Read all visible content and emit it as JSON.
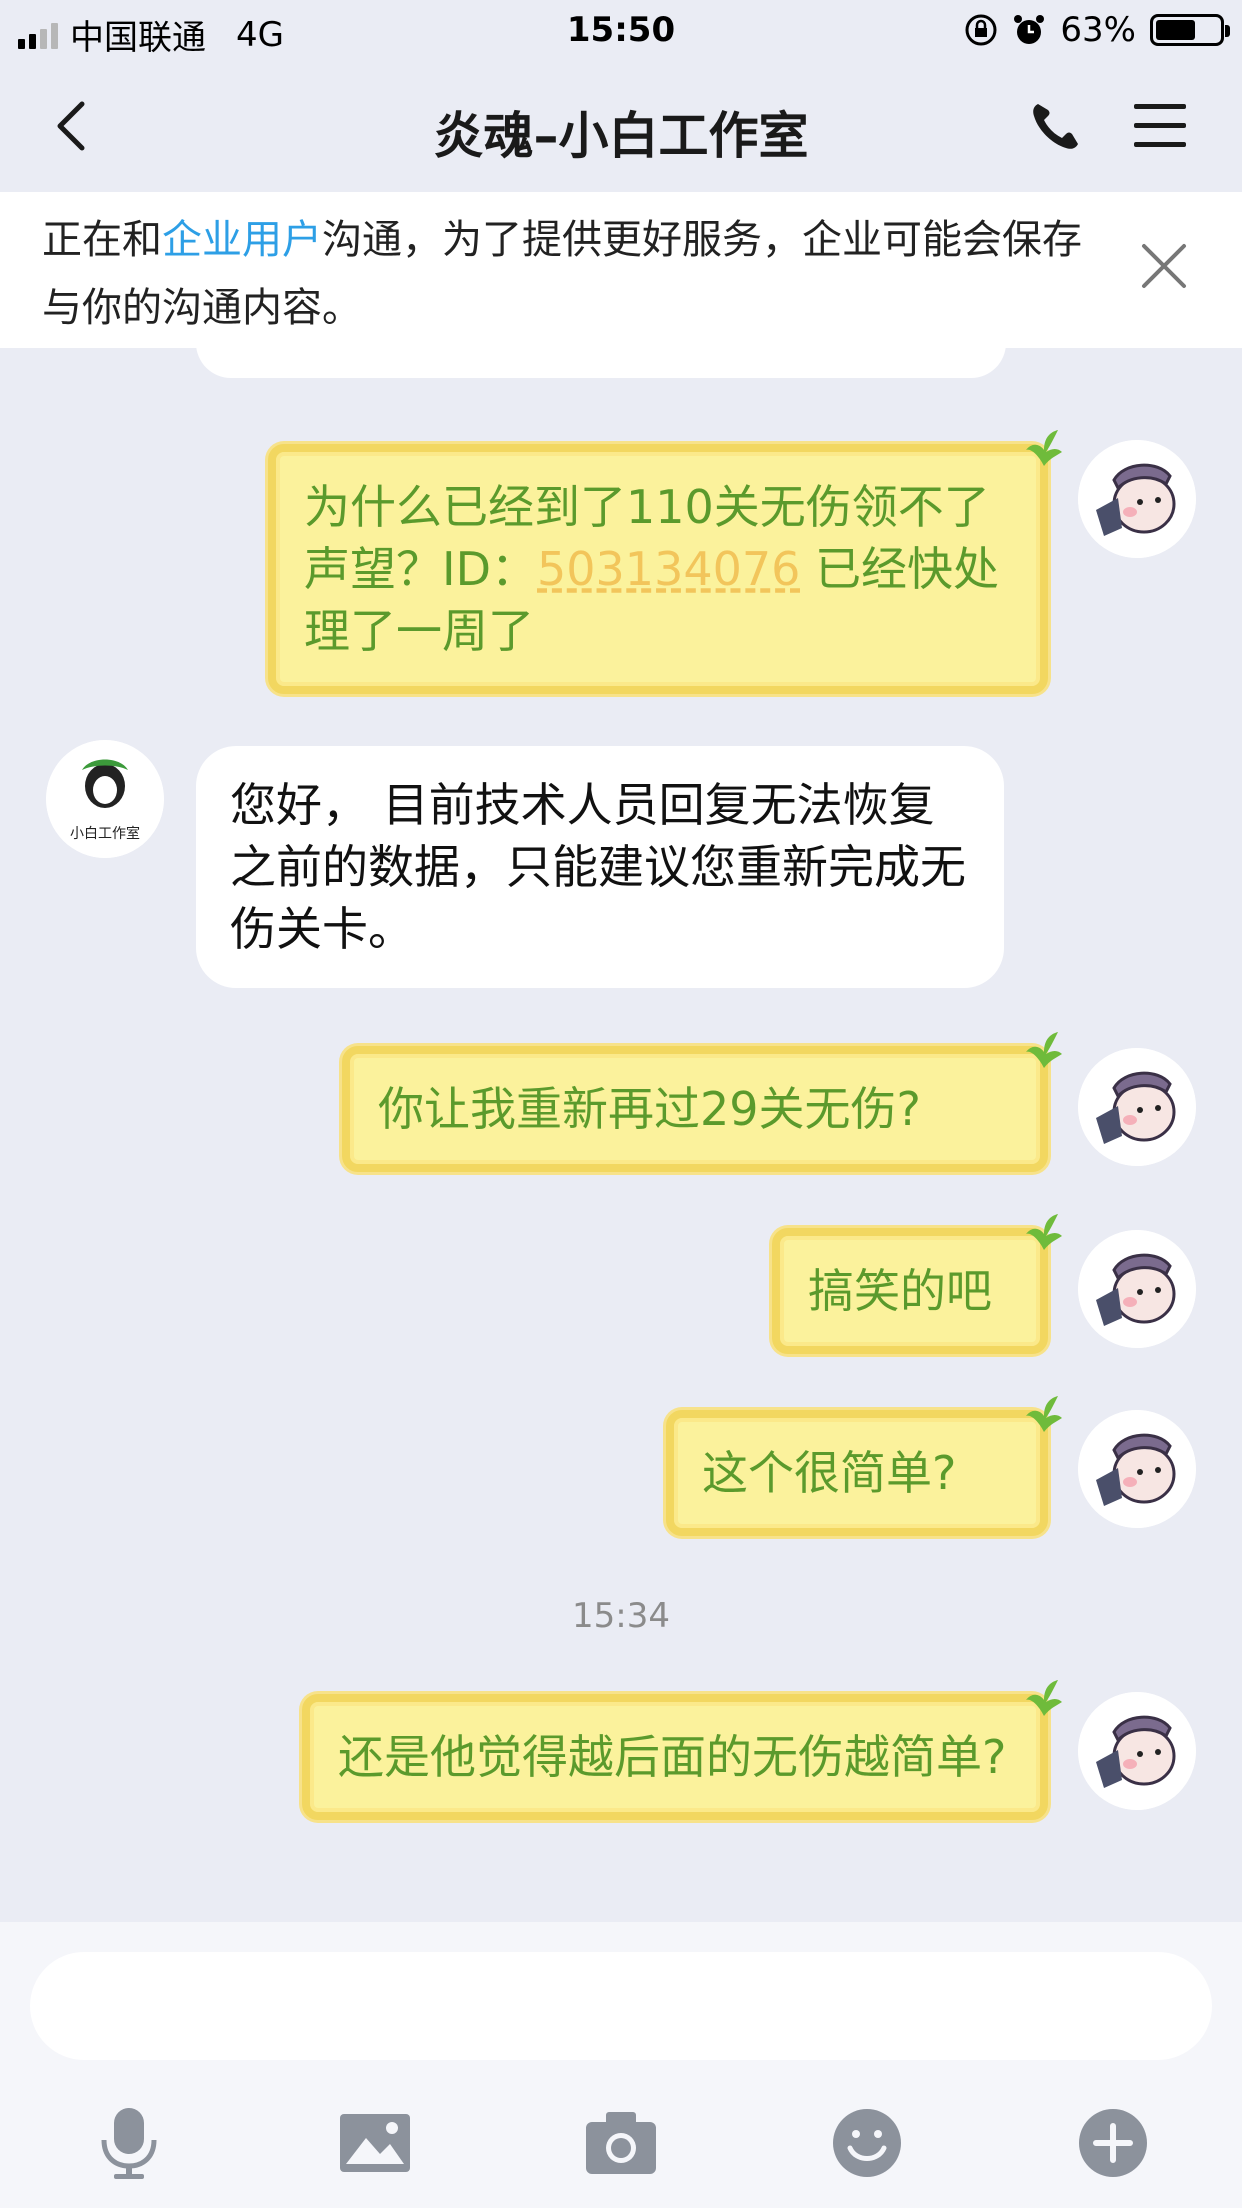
{
  "status_bar": {
    "carrier": "中国联通",
    "network": "4G",
    "time": "15:50",
    "battery": "63%",
    "battery_level": 0.63
  },
  "header": {
    "title": "炎魂–小白工作室"
  },
  "notice": {
    "prefix": "正在和",
    "highlight": "企业用户",
    "suffix": "沟通，为了提供更好服务，企业可能会保存与你的沟通内容。"
  },
  "messages": [
    {
      "side": "out",
      "text_a": "为什么已经到了110关无伤领不了声望？ID：",
      "id": "503134076",
      "text_b": " 已经快处理了一周了"
    },
    {
      "side": "in",
      "text": "您好， 目前技术人员回复无法恢复之前的数据，只能建议您重新完成无伤关卡。",
      "avatar_label": "小白工作室"
    },
    {
      "side": "out",
      "text": "你让我重新再过29关无伤?"
    },
    {
      "side": "out",
      "text": "搞笑的吧"
    },
    {
      "side": "out",
      "text": "这个很简单?"
    },
    {
      "side": "time",
      "text": "15:34"
    },
    {
      "side": "out",
      "text": "还是他觉得越后面的无伤越简单?"
    }
  ],
  "toolbar": {
    "icons": [
      "microphone-icon",
      "image-icon",
      "camera-icon",
      "emoji-icon",
      "plus-icon"
    ]
  },
  "colors": {
    "background": "#eaecf4",
    "link_blue": "#2d9fe6",
    "bubble_out_fill": "#fbf29c",
    "bubble_out_text": "#5b9a2c",
    "id_link": "#f2c55b"
  }
}
